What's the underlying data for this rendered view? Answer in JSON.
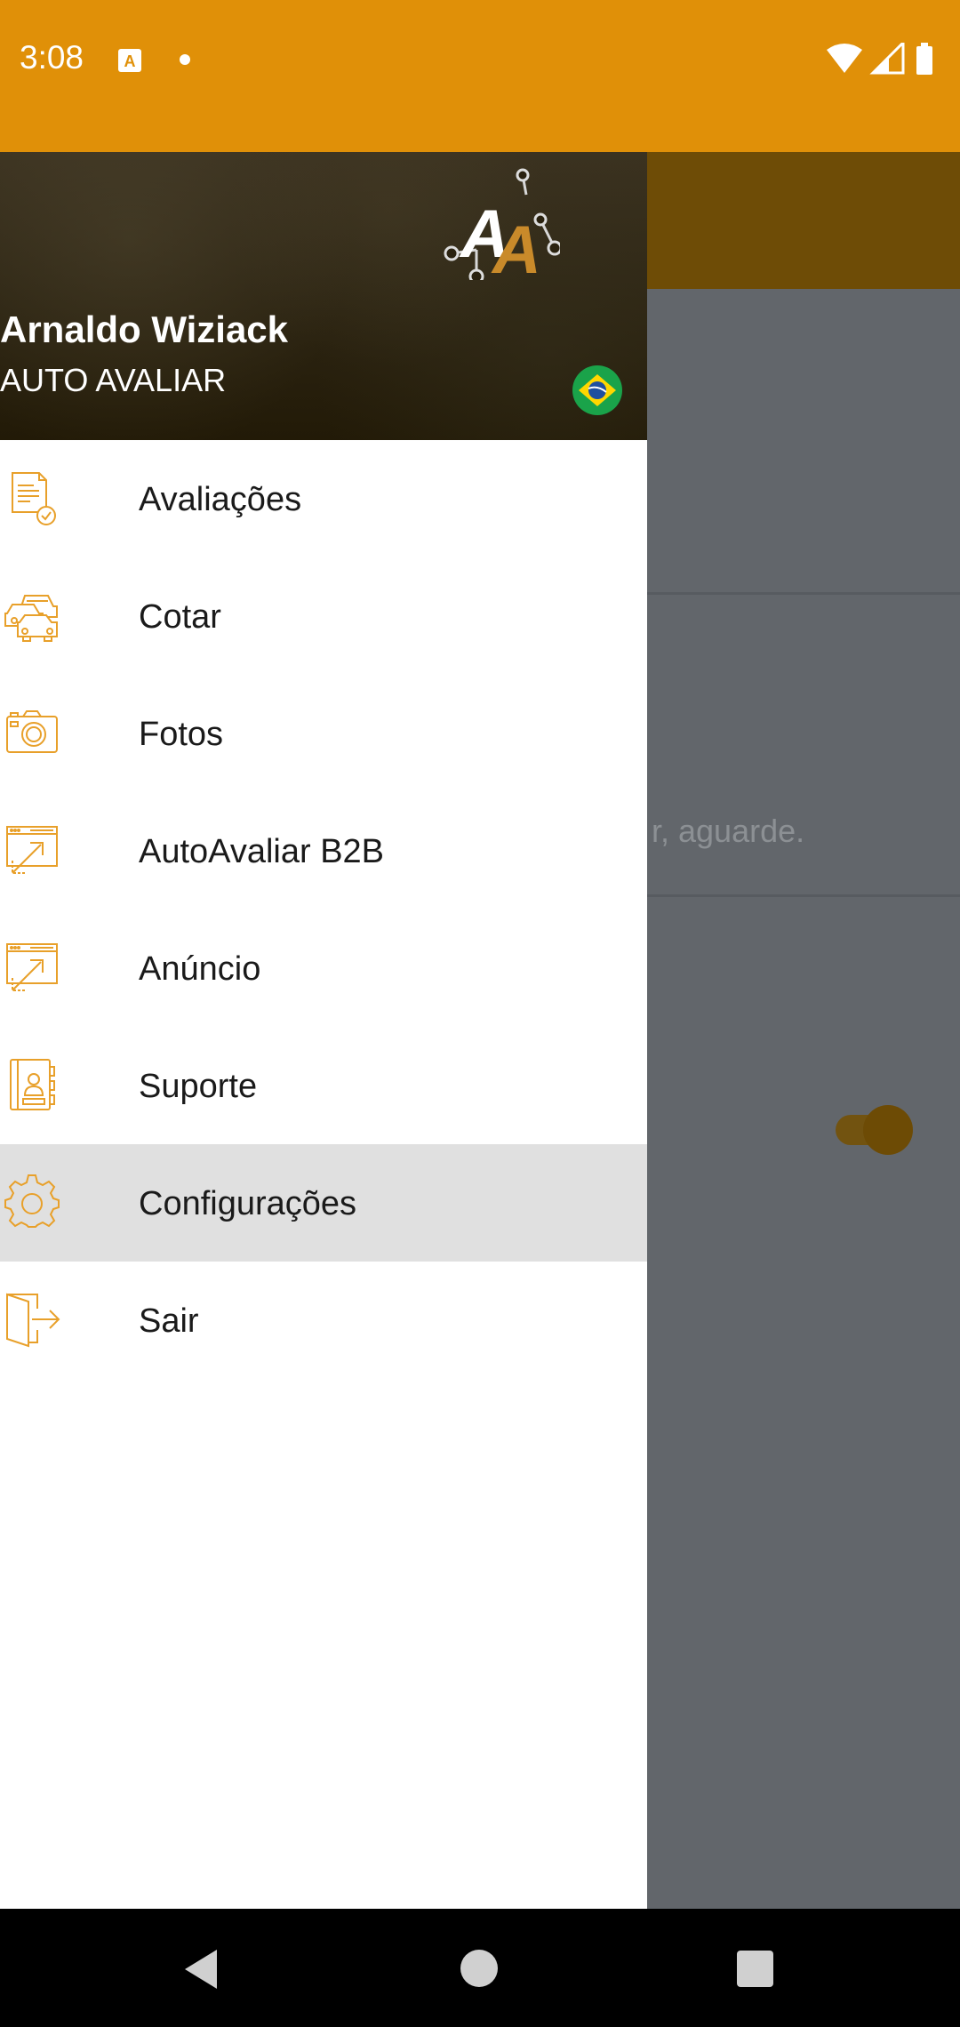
{
  "status_bar": {
    "time": "3:08",
    "icons": [
      "a-notification-icon",
      "dot-icon",
      "wifi-icon",
      "signal-icon",
      "battery-icon"
    ]
  },
  "background_screen": {
    "partial_text": "r, aguarde."
  },
  "drawer": {
    "user_name": "Arnaldo Wiziack",
    "company": "AUTO AVALIAR",
    "logo_text": "AA",
    "menu_items": [
      {
        "label": "Avaliações",
        "icon": "document-check-icon",
        "active": false
      },
      {
        "label": "Cotar",
        "icon": "cars-icon",
        "active": false
      },
      {
        "label": "Fotos",
        "icon": "camera-icon",
        "active": false
      },
      {
        "label": "AutoAvaliar B2B",
        "icon": "browser-arrow-icon",
        "active": false
      },
      {
        "label": "Anúncio",
        "icon": "browser-arrow-icon",
        "active": false
      },
      {
        "label": "Suporte",
        "icon": "contact-book-icon",
        "active": false
      },
      {
        "label": "Configurações",
        "icon": "gear-icon",
        "active": true
      },
      {
        "label": "Sair",
        "icon": "exit-door-icon",
        "active": false
      }
    ]
  },
  "colors": {
    "accent": "#e09008",
    "icon_color": "#e8a02a",
    "active_row": "#e0e0e0"
  }
}
